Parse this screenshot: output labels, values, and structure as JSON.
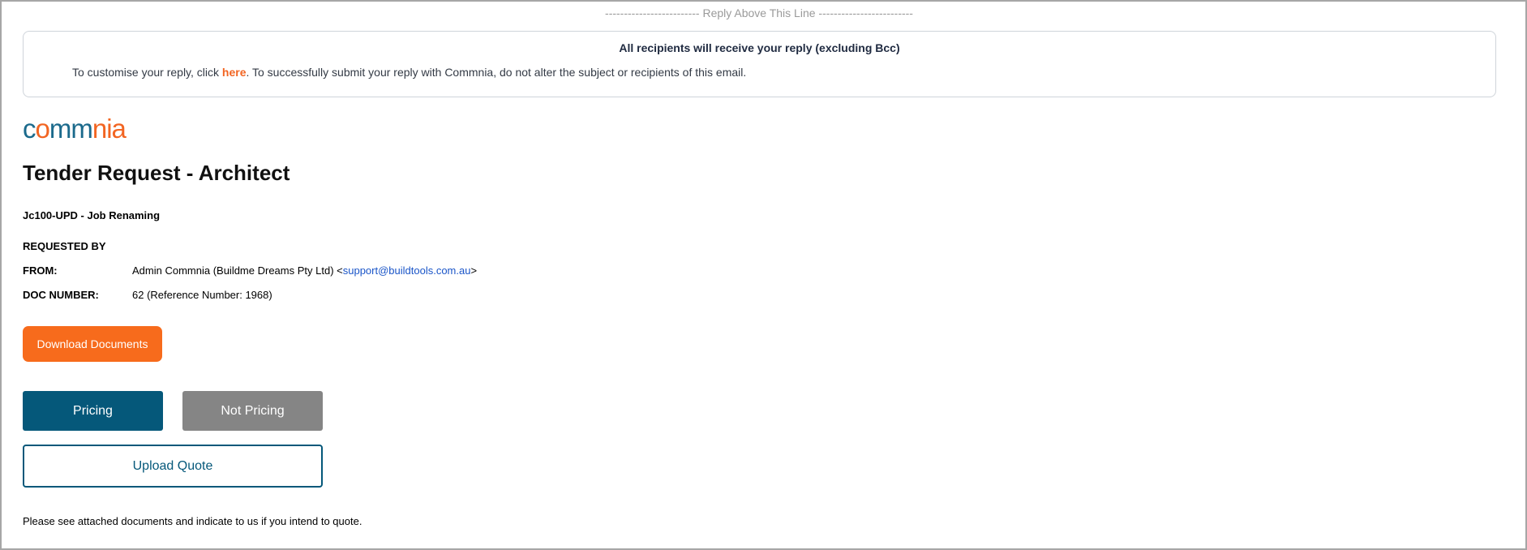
{
  "reply_divider": "------------------------- Reply Above This Line -------------------------",
  "notice": {
    "title": "All recipients will receive your reply (excluding Bcc)",
    "text_before": "To customise your reply, click ",
    "link_label": "here",
    "text_after": ". To successfully submit your reply with Commnia, do not alter the subject or recipients of this email."
  },
  "logo": {
    "part1": "c",
    "part2": "o",
    "part3": "mm",
    "part4": "nia"
  },
  "title": "Tender Request - Architect",
  "job_name": "Jc100-UPD - Job Renaming",
  "requested_by_label": "REQUESTED BY",
  "from": {
    "label": "FROM:",
    "name": "Admin Commnia  (Buildme Dreams Pty Ltd)  <",
    "email": "support@buildtools.com.au",
    "suffix": ">"
  },
  "doc_number": {
    "label": "DOC NUMBER:",
    "value": "62 (Reference Number: 1968)"
  },
  "buttons": {
    "download": "Download Documents",
    "pricing": "Pricing",
    "not_pricing": "Not Pricing",
    "upload": "Upload Quote"
  },
  "footer_text": "Please see attached documents and indicate to us if you intend to quote.",
  "colors": {
    "accent_orange": "#f76b1c",
    "primary_teal": "#05587a",
    "muted_grey": "#858585",
    "link_blue": "#1a55c8"
  }
}
